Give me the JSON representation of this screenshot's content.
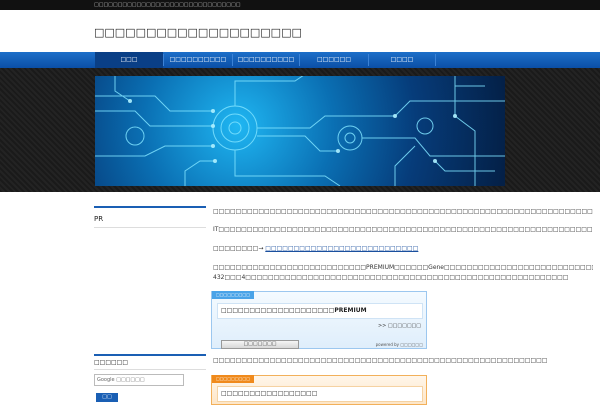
{
  "topbar": {
    "text": "□□□□□□□□□□□□□□□□□□□□□□□□□□□□□□□"
  },
  "header": {
    "site_title": "□□□□□□□□□□□□□□□□□□□□"
  },
  "nav": {
    "items": [
      {
        "label": "□□□",
        "active": true
      },
      {
        "label": "□□□□□□□□□□"
      },
      {
        "label": "□□□□□□□□□□"
      },
      {
        "label": "□□□□□□"
      },
      {
        "label": "□□□□"
      }
    ]
  },
  "sidebar": {
    "pr_heading": "PR",
    "search_heading": "□□□□□□",
    "search_placeholder": "Google □□□□□□",
    "search_button": "□□"
  },
  "main": {
    "para1": "□□□□□□□□□□□□□□□□□□□□□□□□□□□□□□□□□□□□□□□□□□□□□□□□□□□□□□□□□□□□□□□□□□□□□□□□□",
    "para2": "IT□□□□□□□□□□□□□□□□□□□□□□□□□□□□□□□□□□□□□□□□□□□□□□□□□□□□□□□□□□□□□□□□□□□□□□□□",
    "para3_prefix": "□□□□□□□□→ ",
    "para3_link": "□□□□□□□□□□□□□□□□□□□□□□□□□□□",
    "para4_line1": "□□□□□□□□□□□□□□□□□□□□□□□□□□□PREMIUM□□□□□□Gene□□□□□□□□□□□□□□□□□□□□□□□□□□□□□□□□",
    "para4_line2": "432□□□4□□□□□□□□□□□□□□□□□□□□□□□□□□□□□□□□□□□□□□□□□□□□□□□□□□□□□□□□□",
    "para5": "□□□□□□□□□□□□□□□□□□□□□□□□□□□□□□□□□□□□□□□□□□□□□□□□□□□□□□□□□□□"
  },
  "widget1": {
    "tag": "□□□□□□□□□",
    "title": "□□□□□□□□□□□□□□□□□□□□PREMIUM",
    "more": ">> □□□□□□□",
    "button": "□□□□□□□",
    "powered": "powered by □□□□□□"
  },
  "widget2": {
    "tag": "□□□□□□□□□",
    "title": "□□□□□□□□□□□□□□□□□"
  },
  "colors": {
    "nav": "#0b4fa6",
    "accent": "#1a5fb4",
    "widget_blue": "#4aa3e8",
    "widget_orange": "#f08a1c"
  }
}
